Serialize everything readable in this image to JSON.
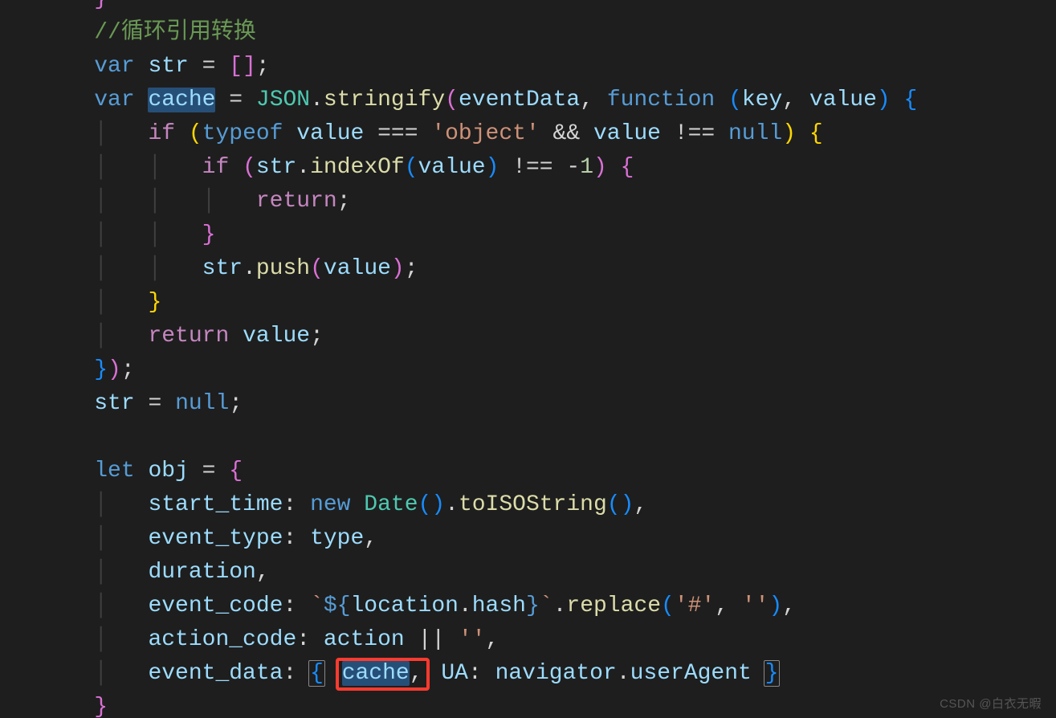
{
  "watermark": "CSDN @白衣无暇",
  "code": {
    "comment_prefix": "//",
    "comment_text": "循环引用转换",
    "l1": {
      "kw": "var",
      "name": "str",
      "eq": " = ",
      "open": "[",
      "close": "]",
      "semi": ";"
    },
    "l2": {
      "kw": "var",
      "name": "cache",
      "eq": " = ",
      "cls": "JSON",
      "dot": ".",
      "fn": "stringify",
      "open": "(",
      "arg1": "eventData",
      "comma": ", ",
      "fnKw": "function ",
      "p2open": "(",
      "key": "key",
      "c2": ", ",
      "value": "value",
      "p2close": ")",
      "sp": " ",
      "brace": "{"
    },
    "l3": {
      "kw": "if ",
      "open": "(",
      "typeof": "typeof ",
      "val": "value",
      "eq": " === ",
      "str": "'object'",
      "and": " && ",
      "val2": "value",
      "neq": " !== ",
      "null": "null",
      "close": ")",
      "sp": " ",
      "brace": "{"
    },
    "l4": {
      "kw": "if ",
      "open": "(",
      "obj": "str",
      "dot": ".",
      "fn": "indexOf",
      "p2": "(",
      "arg": "value",
      "p2c": ")",
      "neq": " !== ",
      "num": "-",
      "one": "1",
      "close": ")",
      "sp": " ",
      "brace": "{"
    },
    "l5": {
      "kw": "return",
      "semi": ";"
    },
    "l6": {
      "brace": "}"
    },
    "l7": {
      "obj": "str",
      "dot": ".",
      "fn": "push",
      "open": "(",
      "arg": "value",
      "close": ")",
      "semi": ";"
    },
    "l8": {
      "brace": "}"
    },
    "l9": {
      "kw": "return ",
      "val": "value",
      "semi": ";"
    },
    "l10": {
      "brace": "}",
      "close": ")",
      "semi": ";"
    },
    "l11": {
      "obj": "str",
      "eq": " = ",
      "null": "null",
      "semi": ";"
    },
    "l12": {
      "kw": "let ",
      "name": "obj",
      "eq": " = ",
      "brace": "{"
    },
    "l13": {
      "key": "start_time",
      "colon": ": ",
      "new": "new ",
      "cls": "Date",
      "p1": "()",
      "dot": ".",
      "fn": "toISOString",
      "p2": "()",
      "comma": ","
    },
    "l14": {
      "key": "event_type",
      "colon": ": ",
      "val": "type",
      "comma": ","
    },
    "l15": {
      "key": "duration",
      "comma": ","
    },
    "l16": {
      "key": "event_code",
      "colon": ": ",
      "tick1": "`",
      "dollar": "${",
      "obj": "location",
      "dot": ".",
      "prop": "hash",
      "close": "}",
      "tick2": "`",
      "dot2": ".",
      "fn": "replace",
      "open": "(",
      "s1": "'#'",
      "c": ", ",
      "s2": "''",
      "close2": ")",
      "comma": ","
    },
    "l17": {
      "key": "action_code",
      "colon": ": ",
      "val": "action",
      "or": " || ",
      "s": "''",
      "comma": ","
    },
    "l18": {
      "key": "event_data",
      "colon": ": ",
      "open": "{",
      "sp": " ",
      "cache": "cache",
      "comma": ",",
      "sp2": " ",
      "ua": "UA",
      "colon2": ": ",
      "nav": "navigator",
      "dot": ".",
      "prop": "userAgent",
      "sp3": " ",
      "close": "}"
    },
    "l19": {
      "brace": "}"
    }
  }
}
